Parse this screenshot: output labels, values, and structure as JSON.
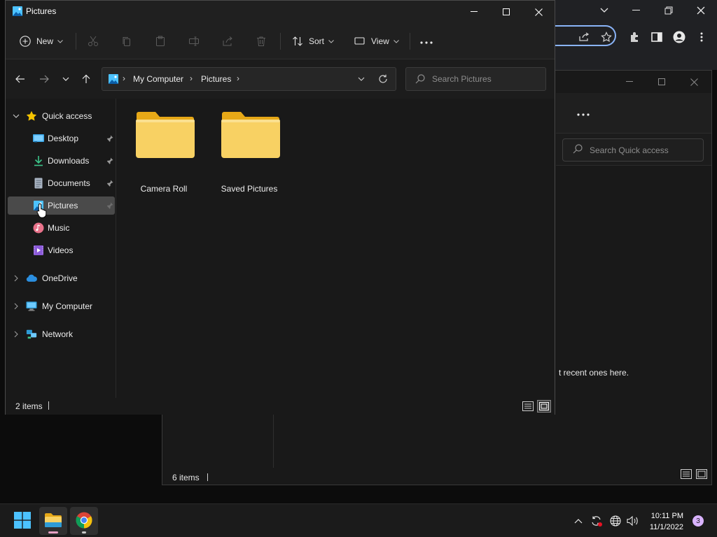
{
  "background_chrome": {
    "icons": [
      "chevron-down-icon",
      "minimize-icon",
      "restore-icon",
      "close-icon",
      "share-icon",
      "star-icon",
      "extensions-icon",
      "side-panel-icon",
      "profile-icon",
      "more-vert-icon"
    ]
  },
  "background_explorer": {
    "search_placeholder": "Search Quick access",
    "empty_message": "t recent ones here.",
    "status_count": "6 items"
  },
  "window": {
    "title": "Pictures",
    "controls": [
      "minimize",
      "maximize",
      "close"
    ]
  },
  "command_bar": {
    "new_label": "New",
    "sort_label": "Sort",
    "view_label": "View",
    "more_label": "...",
    "disabled_icons": [
      "cut-icon",
      "copy-icon",
      "paste-icon",
      "rename-icon",
      "share-icon",
      "delete-icon"
    ]
  },
  "address": {
    "crumbs": [
      "My Computer",
      "Pictures"
    ],
    "search_placeholder": "Search Pictures"
  },
  "nav": {
    "quick_access": "Quick access",
    "items": [
      {
        "label": "Desktop",
        "icon": "desktop-icon",
        "pinned": true
      },
      {
        "label": "Downloads",
        "icon": "download-icon",
        "pinned": true
      },
      {
        "label": "Documents",
        "icon": "documents-icon",
        "pinned": true
      },
      {
        "label": "Pictures",
        "icon": "pictures-icon",
        "pinned": true,
        "selected": true
      },
      {
        "label": "Music",
        "icon": "music-icon",
        "pinned": false
      },
      {
        "label": "Videos",
        "icon": "videos-icon",
        "pinned": false
      }
    ],
    "onedrive": "OneDrive",
    "my_computer": "My Computer",
    "network": "Network"
  },
  "content": {
    "folders": [
      {
        "name": "Camera Roll"
      },
      {
        "name": "Saved Pictures"
      }
    ]
  },
  "status": {
    "count": "2 items"
  },
  "taskbar": {
    "apps": [
      "start-icon",
      "file-explorer-icon",
      "chrome-icon"
    ],
    "time": "10:11 PM",
    "date": "11/1/2022",
    "notification_count": "3"
  },
  "colors": {
    "accent": "#4cc2ff",
    "folder_yellow": "#f8d163",
    "selection_bg": "#4a4a4a",
    "window_bg": "#191919"
  }
}
